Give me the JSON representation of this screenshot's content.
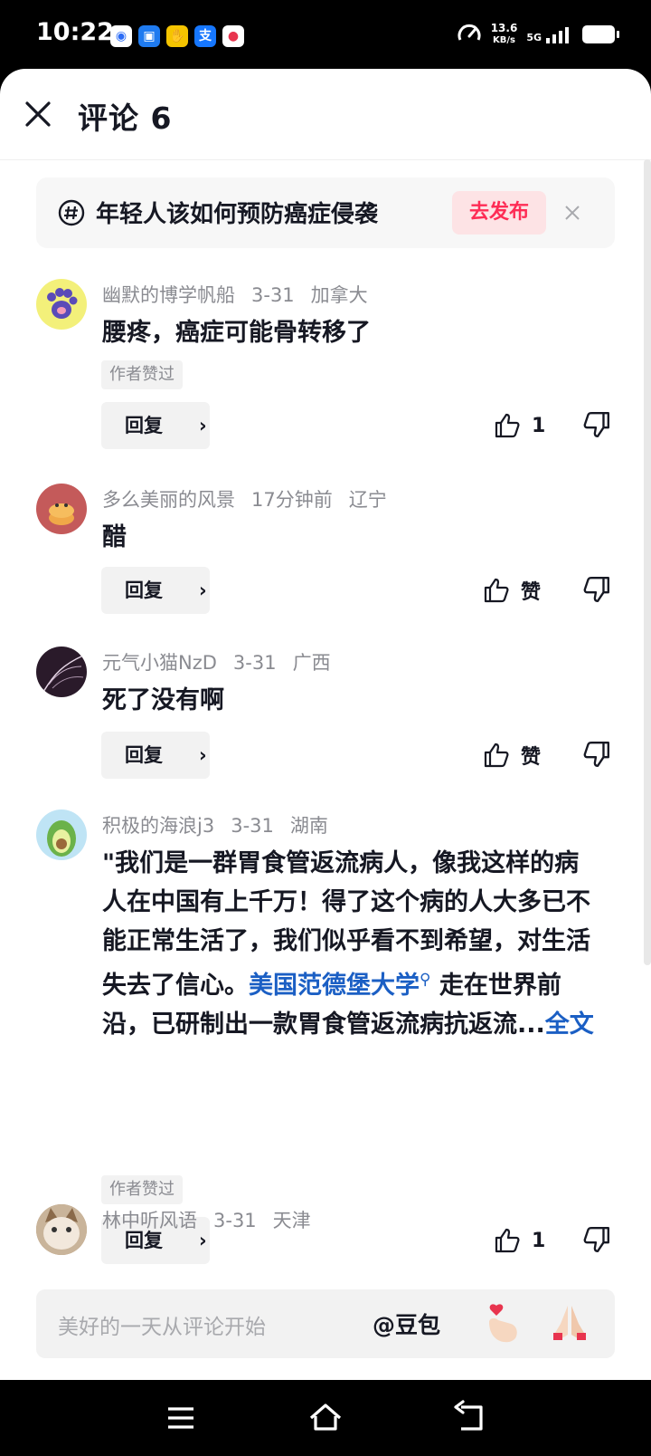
{
  "status_bar": {
    "time": "10:22",
    "speed_value": "13.6",
    "speed_unit": "KB/s",
    "network": "5G"
  },
  "header": {
    "title": "评论 6"
  },
  "topic": {
    "text": "年轻人该如何预防癌症侵袭",
    "button_label": "去发布"
  },
  "comments": [
    {
      "username": "幽默的博学帆船",
      "date": "3-31",
      "location": "加拿大",
      "text": "腰疼，癌症可能骨转移了",
      "badge": "作者赞过",
      "reply_label": "回复",
      "like_label": "1"
    },
    {
      "username": "多么美丽的风景",
      "date": "17分钟前",
      "location": "辽宁",
      "text": "醋",
      "reply_label": "回复",
      "like_label": "赞"
    },
    {
      "username": "元气小猫NzD",
      "date": "3-31",
      "location": "广西",
      "text": "死了没有啊",
      "reply_label": "回复",
      "like_label": "赞"
    },
    {
      "username": "积极的海浪j3",
      "date": "3-31",
      "location": "湖南",
      "text_part1": "\"我们是一群胃食管返流病人，像我这样的病人在中国有上千万！得了这个病的人大多已不能正常生活了，我们似乎看不到希望，对生活失去了信心。",
      "link_text": "美国范德堡大学",
      "text_part2": " 走在世界前沿，已研制出一款胃食管返流病抗返流...",
      "full_text_link": "全文",
      "badge": "作者赞过",
      "reply_label": "回复",
      "like_label": "1"
    },
    {
      "username": "林中听风语",
      "date": "3-31",
      "location": "天津"
    }
  ],
  "input_bar": {
    "placeholder": "美好的一天从评论开始",
    "mention": "@豆包"
  },
  "colors": {
    "accent": "#fe2c55",
    "link": "#1b5fc4",
    "muted": "#8a8b91"
  }
}
